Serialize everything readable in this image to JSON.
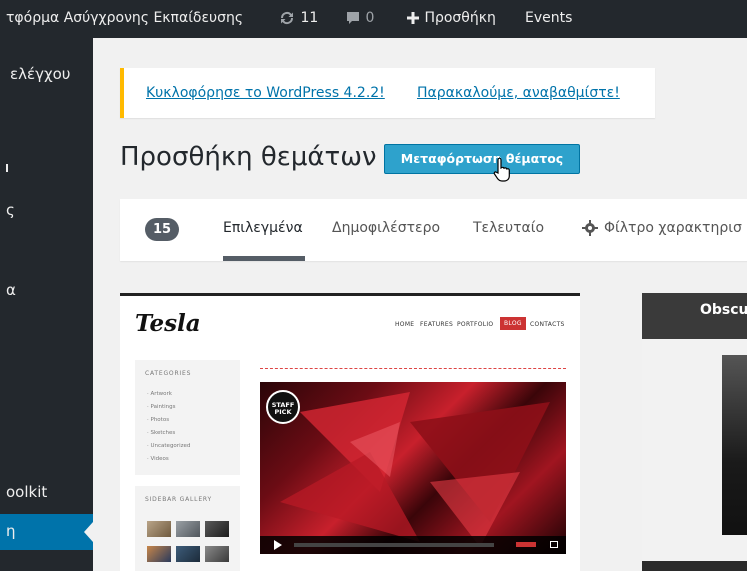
{
  "adminbar": {
    "site_name": "τφόρμα Ασύγχρονης Εκπαίδευσης",
    "updates_count": "11",
    "comments_count": "0",
    "new_label": "Προσθήκη",
    "events_label": "Events"
  },
  "adminmenu": {
    "items": [
      "ελέγχου",
      "ς",
      "α",
      "oolkit",
      "η"
    ]
  },
  "notice": {
    "update_text": "Κυκλοφόρησε το WordPress 4.2.2!",
    "update_link": "Παρακαλούμε, αναβαθμίστε!"
  },
  "page": {
    "title": "Προσθήκη θεμάτων",
    "upload_button": "Μεταφόρτωση θέματος"
  },
  "filter": {
    "count": "15",
    "tabs": [
      "Επιλεγμένα",
      "Δημοφιλέστερο",
      "Τελευταίο"
    ],
    "feature_filter": "Φίλτρο χαρακτηρισ"
  },
  "themes": [
    {
      "logo": "Tesla",
      "nav": [
        "HOME",
        "FEATURES",
        "PORTFOLIO",
        "BLOG",
        "CONTACTS"
      ],
      "categories_title": "CATEGORIES",
      "categories": [
        "Artwork",
        "Paintings",
        "Photos",
        "Sketches",
        "Uncategorized",
        "Videos"
      ],
      "gallery_title": "SIDEBAR GALLERY",
      "badge": "STAFF PICK"
    },
    {
      "title": "Obscu"
    }
  ],
  "colors": {
    "adminbar_bg": "#23282d",
    "accent": "#0073aa",
    "button": "#2ea2cc",
    "notice_border": "#ffba00"
  }
}
